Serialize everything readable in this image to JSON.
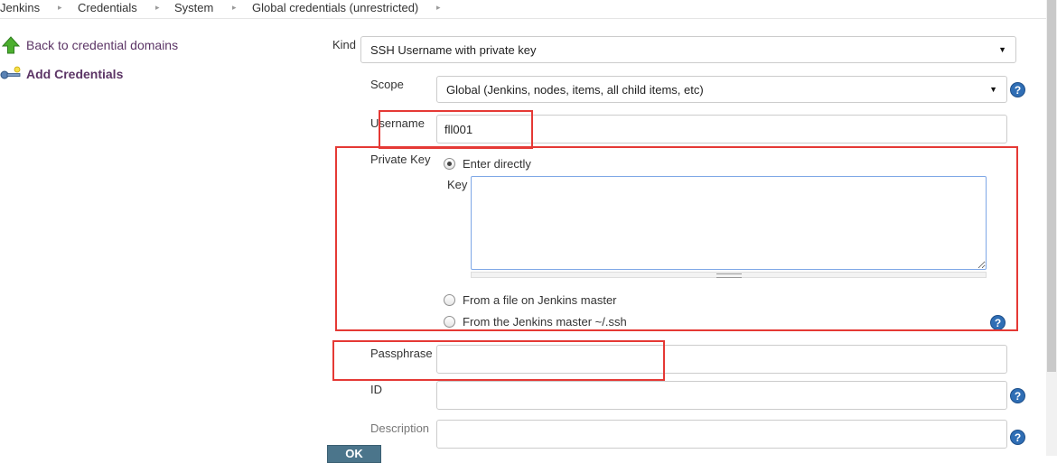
{
  "breadcrumb": {
    "items": [
      "Jenkins",
      "Credentials",
      "System",
      "Global credentials (unrestricted)"
    ],
    "separator": "▸"
  },
  "sidebar": {
    "back_link": "Back to credential domains",
    "add_credentials": "Add Credentials"
  },
  "form": {
    "kind": {
      "label": "Kind",
      "value": "SSH Username with private key"
    },
    "scope": {
      "label": "Scope",
      "value": "Global (Jenkins, nodes, items, all child items, etc)"
    },
    "username": {
      "label": "Username",
      "value": "fll001"
    },
    "private_key": {
      "label": "Private Key",
      "options": [
        {
          "label": "Enter directly",
          "checked": true
        },
        {
          "label": "From a file on Jenkins master",
          "checked": false
        },
        {
          "label": "From the Jenkins master ~/.ssh",
          "checked": false
        }
      ],
      "key_label": "Key",
      "key_value": ""
    },
    "passphrase": {
      "label": "Passphrase",
      "value": ""
    },
    "id": {
      "label": "ID",
      "value": ""
    },
    "description": {
      "label": "Description",
      "value": ""
    },
    "ok_label": "OK",
    "help_glyph": "?",
    "dropdown_arrow": "▼"
  },
  "colors": {
    "link": "#5c3566",
    "annotation_red": "#e53935",
    "help_blue": "#2f6eb5",
    "button": "#4b758b",
    "textarea_focus": "#7ea7e6"
  }
}
